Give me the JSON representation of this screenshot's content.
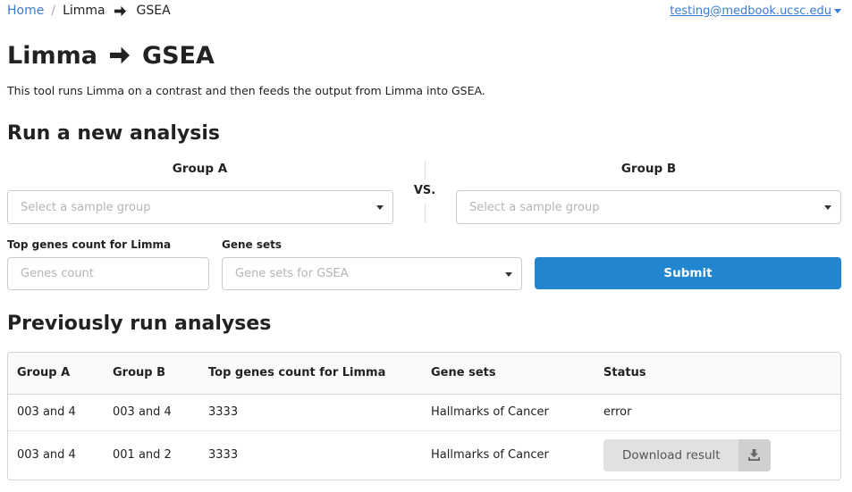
{
  "breadcrumb": {
    "home": "Home",
    "separator": "/",
    "current_part1": "Limma",
    "current_part2": "GSEA"
  },
  "user": {
    "email": "testing@medbook.ucsc.edu"
  },
  "page": {
    "title_part1": "Limma",
    "title_part2": "GSEA",
    "description": "This tool runs Limma on a contrast and then feeds the output from Limma into GSEA."
  },
  "new_analysis": {
    "heading": "Run a new analysis",
    "group_a_label": "Group A",
    "group_b_label": "Group B",
    "vs_label": "VS.",
    "group_a_placeholder": "Select a sample group",
    "group_b_placeholder": "Select a sample group",
    "top_genes_label": "Top genes count for Limma",
    "top_genes_placeholder": "Genes count",
    "gene_sets_label": "Gene sets",
    "gene_sets_placeholder": "Gene sets for GSEA",
    "submit_label": "Submit"
  },
  "previous": {
    "heading": "Previously run analyses",
    "columns": [
      "Group A",
      "Group B",
      "Top genes count for Limma",
      "Gene sets",
      "Status"
    ],
    "rows": [
      {
        "group_a": "003 and 4",
        "group_b": "003 and 4",
        "top_genes": "3333",
        "gene_sets": "Hallmarks of Cancer",
        "status": "error"
      },
      {
        "group_a": "003 and 4",
        "group_b": "001 and 2",
        "top_genes": "3333",
        "gene_sets": "Hallmarks of Cancer",
        "status_button": "Download result"
      }
    ]
  },
  "icons": {
    "breadcrumb_arrow": "arrow-right-icon",
    "title_arrow": "arrow-right-icon",
    "user_caret": "caret-down-icon",
    "select_caret": "caret-down-icon",
    "download": "download-icon"
  },
  "colors": {
    "link": "#3a7bd5",
    "primary_button": "#2185d0",
    "secondary_button": "#e0e1e2"
  }
}
